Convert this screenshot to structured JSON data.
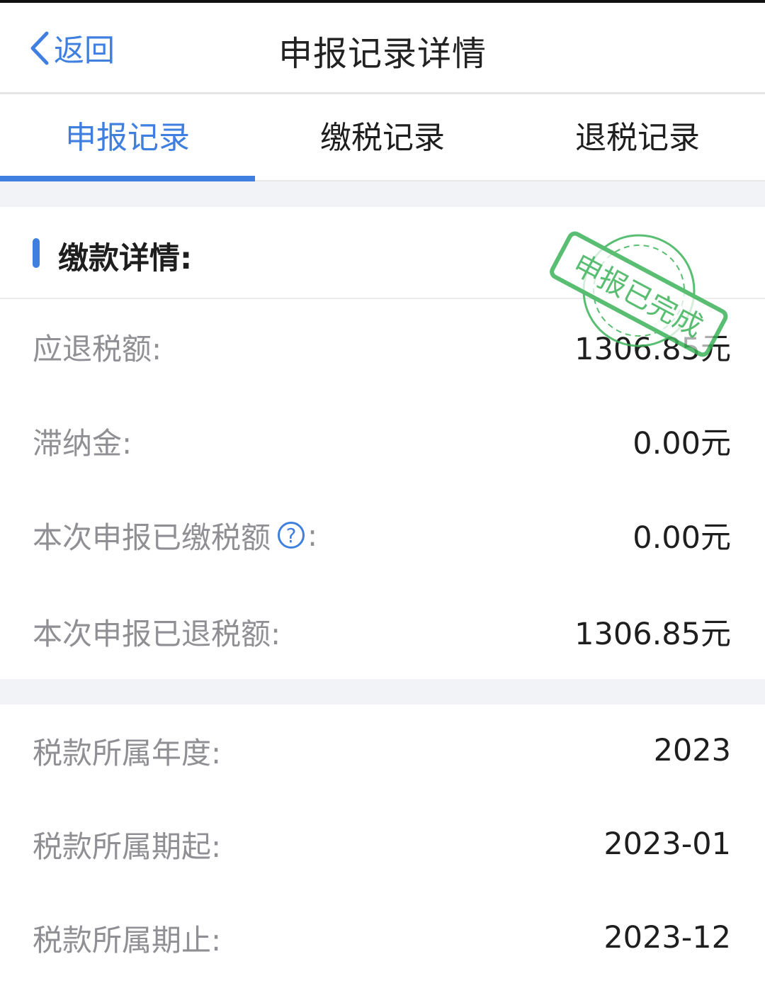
{
  "header": {
    "back_label": "返回",
    "title": "申报记录详情"
  },
  "tabs": [
    {
      "label": "申报记录",
      "active": true
    },
    {
      "label": "缴税记录",
      "active": false
    },
    {
      "label": "退税记录",
      "active": false
    }
  ],
  "payment_section": {
    "title": "缴款详情:",
    "rows": [
      {
        "label": "应退税额:",
        "value": "1306.85元"
      },
      {
        "label": "滞纳金:",
        "value": "0.00元"
      },
      {
        "label": "本次申报已缴税额",
        "label_suffix": ":",
        "value": "0.00元",
        "has_help": true
      },
      {
        "label": "本次申报已退税额:",
        "value": "1306.85元"
      }
    ]
  },
  "period_section": {
    "rows": [
      {
        "label": "税款所属年度:",
        "value": "2023"
      },
      {
        "label": "税款所属期起:",
        "value": "2023-01"
      },
      {
        "label": "税款所属期止:",
        "value": "2023-12"
      }
    ]
  },
  "stamp": {
    "text": "申报已完成",
    "color": "#3db35a"
  },
  "colors": {
    "accent": "#3f7fe0",
    "label_gray": "#8f8f94",
    "section_gap": "#f2f3f7"
  },
  "icons": {
    "back": "chevron-left-icon",
    "help": "question-circle-icon"
  }
}
